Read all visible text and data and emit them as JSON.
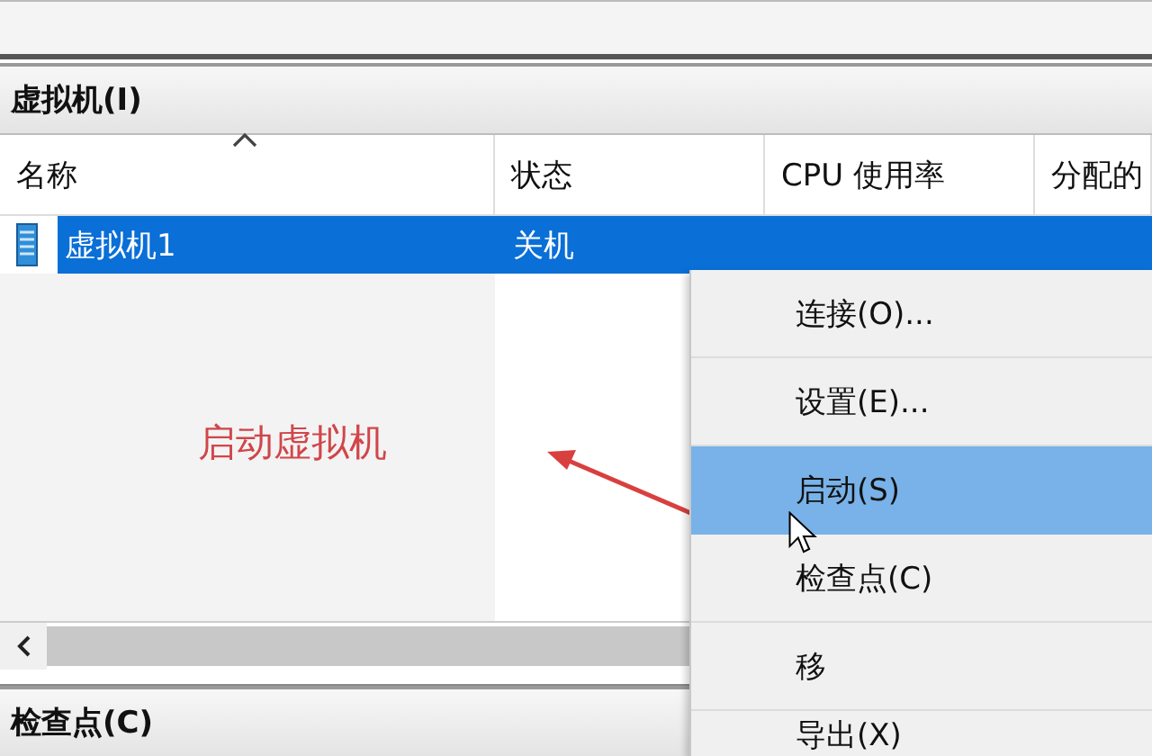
{
  "vm_section": {
    "title": "虚拟机(I)",
    "columns": [
      {
        "label": "名称",
        "sorted": true
      },
      {
        "label": "状态",
        "sorted": false
      },
      {
        "label": "CPU 使用率",
        "sorted": false
      },
      {
        "label": "分配的",
        "sorted": false
      }
    ],
    "rows": [
      {
        "name": "虚拟机1",
        "state": "关机",
        "selected": true
      }
    ]
  },
  "annotation": {
    "text": "启动虚拟机"
  },
  "context_menu": [
    {
      "label": "连接(O)...",
      "selected": false
    },
    {
      "label": "设置(E)...",
      "selected": false
    },
    {
      "label": "启动(S)",
      "selected": true
    },
    {
      "label": "检查点(C)",
      "selected": false
    },
    {
      "label": "移",
      "selected": false
    },
    {
      "label": "导出(X)",
      "selected": false
    }
  ],
  "checkpoint_section": {
    "title": "检查点(C)"
  }
}
